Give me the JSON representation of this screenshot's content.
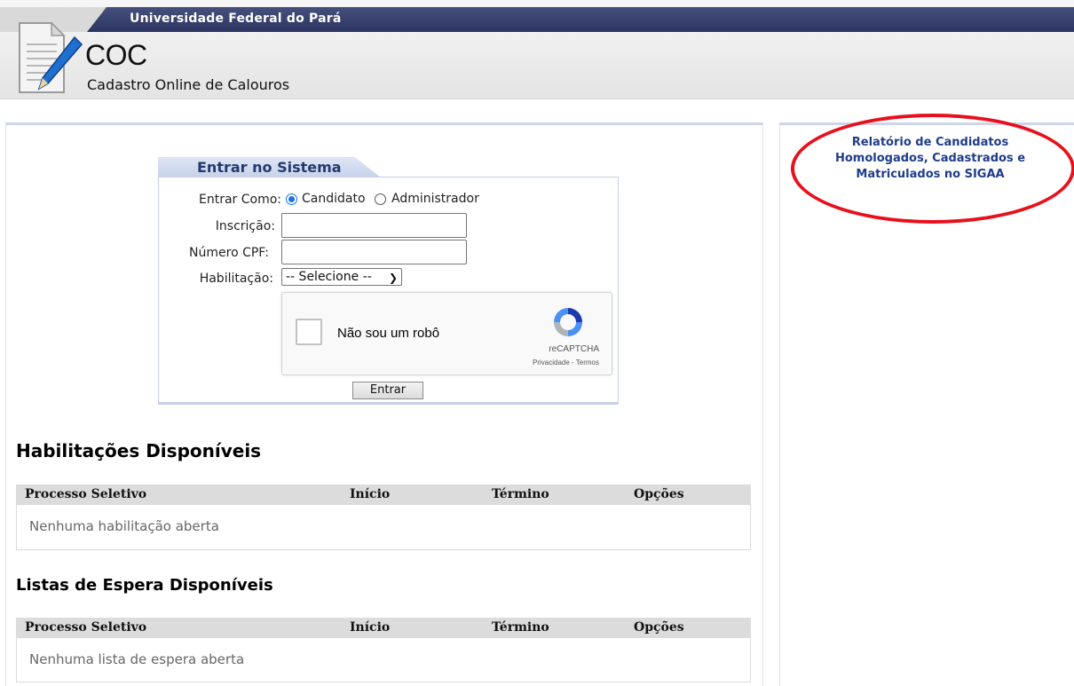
{
  "header": {
    "university": "Universidade Federal do Pará",
    "app_name": "COC",
    "app_subtitle": "Cadastro Online de Calouros"
  },
  "login": {
    "title": "Entrar no Sistema",
    "enter_as_label": "Entrar Como:",
    "options": [
      "Candidato",
      "Administrador"
    ],
    "selected_option": "Candidato",
    "inscricao_label": "Inscrição:",
    "inscricao_value": "",
    "cpf_label": "Número CPF:",
    "cpf_value": "",
    "habilitacao_label": "Habilitação:",
    "habilitacao_selected": "-- Selecione --",
    "captcha": {
      "text": "Não sou um robô",
      "brand": "reCAPTCHA",
      "terms": "Privacidade - Termos"
    },
    "submit_label": "Entrar"
  },
  "habilitacoes": {
    "title": "Habilitações Disponíveis",
    "columns": [
      "Processo Seletivo",
      "Início",
      "Término",
      "Opções"
    ],
    "empty_text": "Nenhuma habilitação aberta"
  },
  "listas": {
    "title": "Listas de Espera Disponíveis",
    "columns": [
      "Processo Seletivo",
      "Início",
      "Término",
      "Opções"
    ],
    "empty_text": "Nenhuma lista de espera aberta"
  },
  "sidebar": {
    "report_link_lines": [
      "Relatório de Candidatos",
      "Homologados, Cadastrados e",
      "Matriculados no SIGAA"
    ]
  },
  "colors": {
    "univ_bar": "#2c3561",
    "link": "#1f3d8a",
    "highlight_circle": "#e8101c"
  }
}
